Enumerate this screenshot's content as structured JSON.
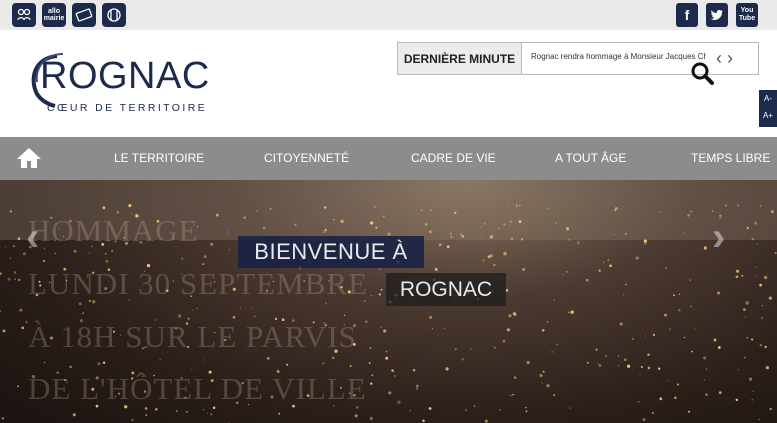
{
  "quick_links": [
    {
      "icon": "family-icon"
    },
    {
      "icon": "allo-mairie-icon",
      "label": "allo\nmairie"
    },
    {
      "icon": "ticket-icon"
    },
    {
      "icon": "restaurant-icon"
    }
  ],
  "social": [
    {
      "icon": "facebook-icon",
      "glyph": "f"
    },
    {
      "icon": "twitter-icon",
      "glyph": "t"
    },
    {
      "icon": "youtube-icon",
      "glyph": "You\nTube"
    }
  ],
  "logo": {
    "word": "ROGNAC",
    "tagline": "CŒUR DE TERRITOIRE"
  },
  "news": {
    "label": "DERNIÈRE MINUTE",
    "text": "Rognac rendra hommage à Monsieur Jacques Chirac,"
  },
  "a11y": {
    "minus": "A-",
    "plus": "A+"
  },
  "nav": {
    "items": [
      "LE TERRITOIRE",
      "CITOYENNETÉ",
      "CADRE DE VIE",
      "A TOUT ÂGE",
      "TEMPS LIBRE"
    ]
  },
  "hero": {
    "ghost_lines": [
      "HOMMAGE",
      "LUNDI 30 SEPTEMBRE",
      "À 18H SUR LE PARVIS",
      "DE L'HÔTEL DE VILLE"
    ],
    "banner1": "BIENVENUE À",
    "banner2": "ROGNAC"
  },
  "colors": {
    "navy": "#1d2a4c",
    "nav_bg": "#8c8c8c",
    "top_bg": "#eaeaea"
  }
}
